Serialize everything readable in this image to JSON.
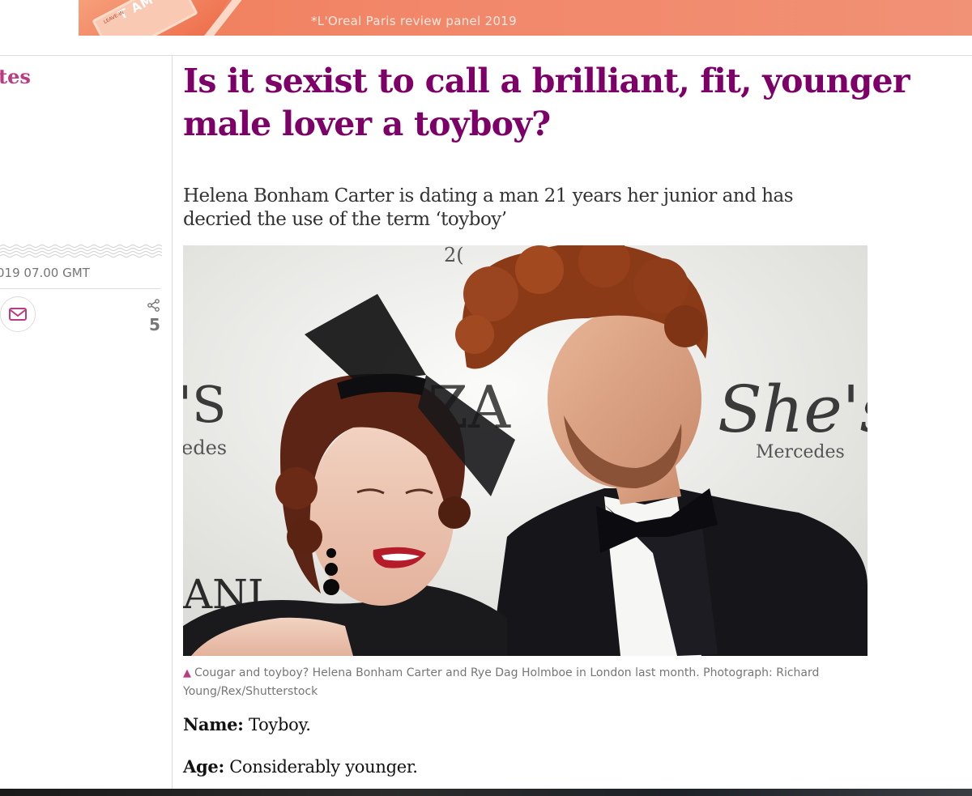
{
  "ad": {
    "caption": "*L'Oreal Paris review panel 2019",
    "product_text": "T AM",
    "product_small": "LEAVE-IN",
    "background": "#f0845e"
  },
  "left": {
    "section_label": "tes",
    "dateline": "019 07.00 GMT",
    "share_count": "5",
    "icons": [
      "email-icon",
      "share-icon"
    ]
  },
  "article": {
    "headline": "Is it sexist to call a brilliant, fit, younger male lover a toyboy?",
    "standfirst": "Helena Bonham Carter is dating a man 21 years her junior and has decried the use of the term ‘toyboy’",
    "photo": {
      "backdrop_texts": [
        "'S",
        "edes",
        "ANI",
        "ZA",
        "2(",
        "She's",
        "Mercedes"
      ]
    },
    "caption_icon": "triangle-icon",
    "caption": "Cougar and toyboy? Helena Bonham Carter and Rye Dag Holmboe in London last month. Photograph: Richard Young/Rex/Shutterstock",
    "paragraphs": [
      {
        "label": "Name:",
        "text": " Toyboy."
      },
      {
        "label": "Age:",
        "text": " Considerably younger."
      }
    ]
  },
  "colors": {
    "headline": "#7d0068",
    "section": "#bb3b80",
    "meta": "#767676"
  }
}
